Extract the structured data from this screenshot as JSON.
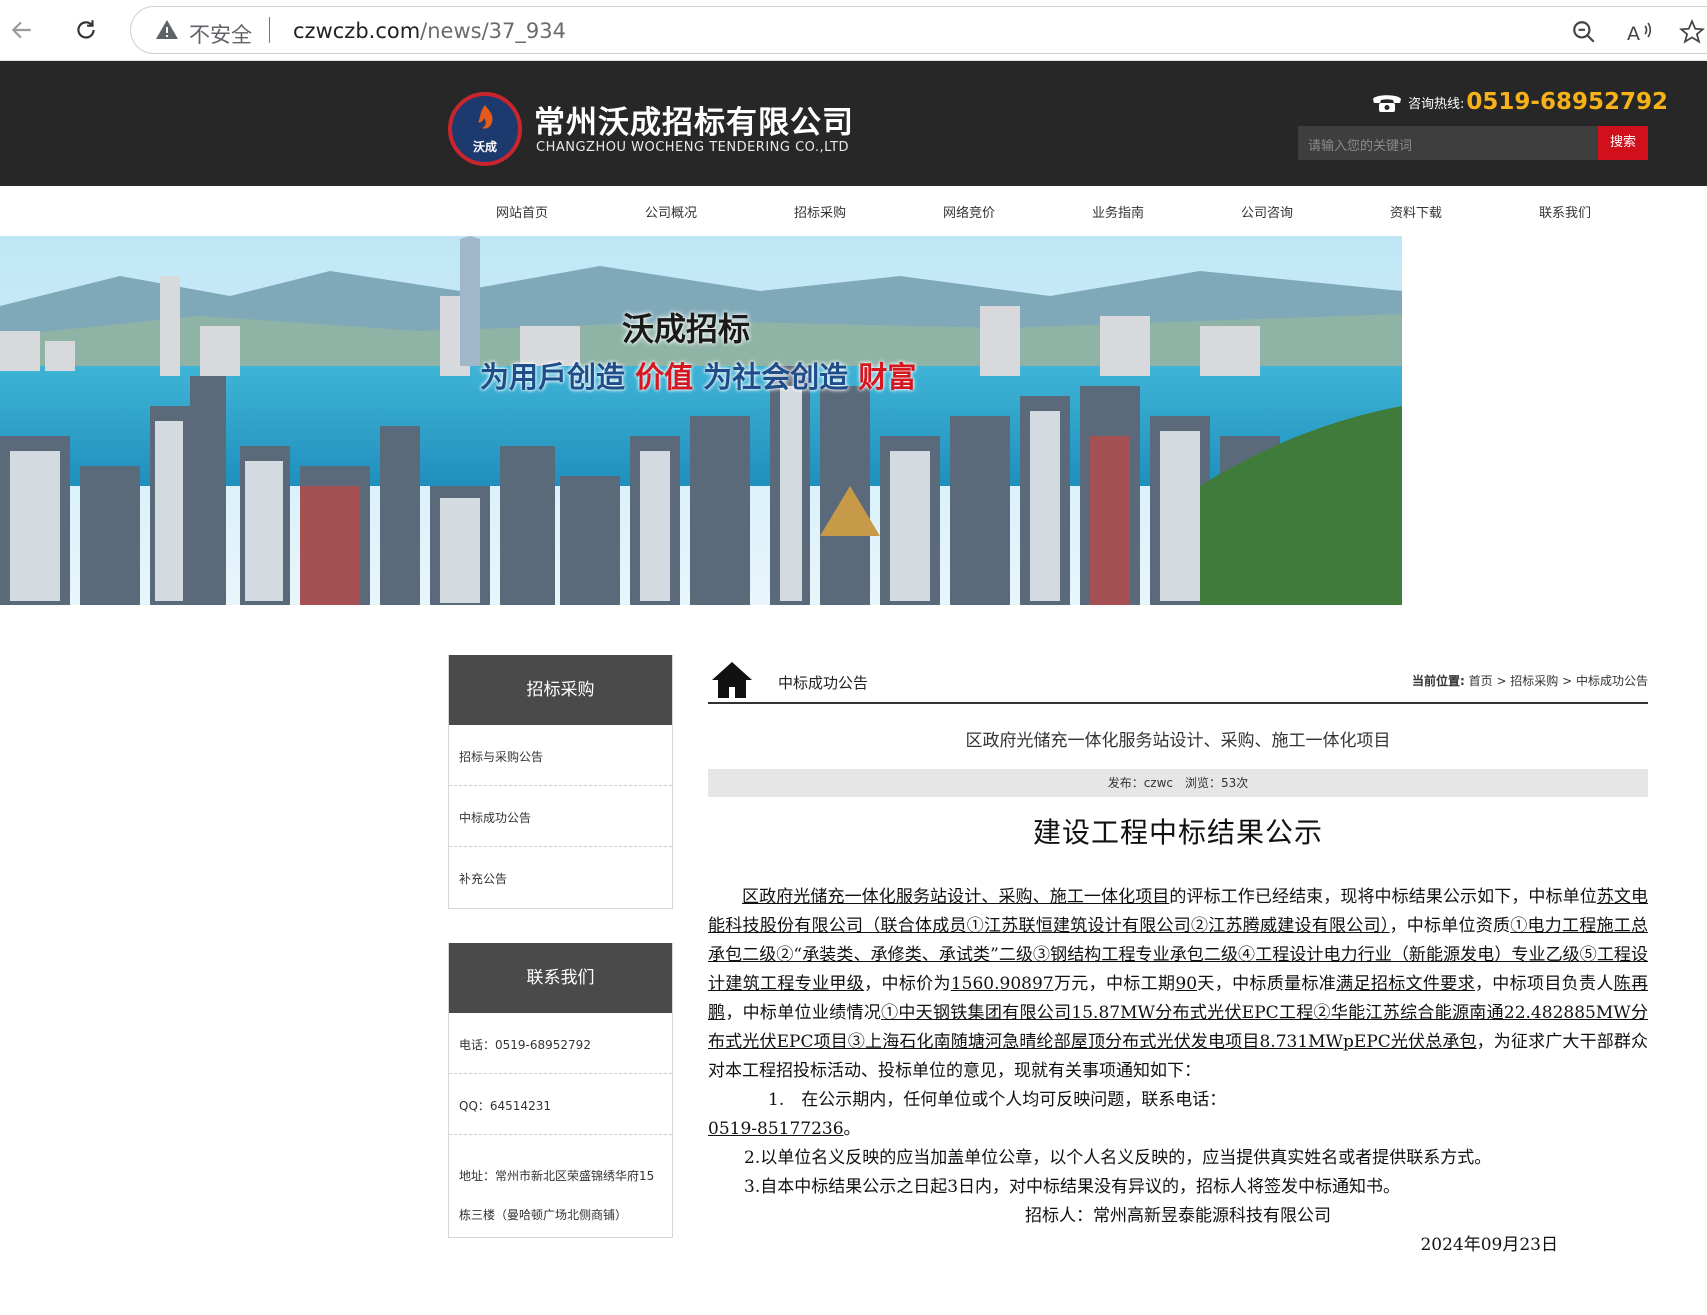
{
  "browser": {
    "insecure_label": "不安全",
    "url_host": "czwczb.com",
    "url_path": "/news/37_934"
  },
  "header": {
    "logo_text": "沃成",
    "company_name": "常州沃成招标有限公司",
    "company_en": "CHANGZHOU WOCHENG TENDERING CO.,LTD",
    "hotline_label": "咨询热线:",
    "hotline_number": "0519-68952792",
    "search_placeholder": "请输入您的关键词",
    "search_button": "搜索"
  },
  "nav": [
    "网站首页",
    "公司概况",
    "招标采购",
    "网络竞价",
    "业务指南",
    "公司咨询",
    "资料下载",
    "联系我们"
  ],
  "banner": {
    "title": "沃成招标",
    "slogan_1": "为用戶创造",
    "slogan_2": "价值",
    "slogan_3": "为社会创造",
    "slogan_4": "财富"
  },
  "sidebar": {
    "bidding": {
      "title": "招标采购",
      "items": [
        "招标与采购公告",
        "中标成功公告",
        "补充公告"
      ]
    },
    "contact": {
      "title": "联系我们",
      "phone": "电话：0519-68952792",
      "qq": "QQ：64514231",
      "address": "地址：常州市新北区荣盛锦绣华府15栋三楼（曼哈顿广场北侧商铺）"
    }
  },
  "content": {
    "section_title": "中标成功公告",
    "breadcrumb_label": "当前位置:",
    "breadcrumb": "首页 > 招标采购 > 中标成功公告",
    "article_title": "区政府光储充一体化服务站设计、采购、施工一体化项目",
    "meta": "发布：czwc　浏览：53次",
    "doc_title": "建设工程中标结果公示",
    "p1_a": "区政府光储充一体化服务站设计、采购、施工一体化项目",
    "p1_b": "的评标工作已经结束，现将中标结果公示如下，中标单位",
    "p1_c": "苏文电能科技股份有限公司（联合体成员①江苏联恒建筑设计有限公司②江苏腾威建设有限公司）",
    "p1_d": "，中标单位资质",
    "p1_e": "①电力工程施工总承包二级②“承装类、承修类、承试类”二级③钢结构工程专业承包二级④工程设计电力行业（新能源发电）专业乙级⑤工程设计建筑工程专业甲级",
    "p1_f": "，中标价为",
    "p1_g": "1560.90897",
    "p1_h": "万元，中标工期",
    "p1_i": "90",
    "p1_j": "天，中标质量标准",
    "p1_k": "满足招标文件要求",
    "p1_l": "，中标项目负责人",
    "p1_m": "陈再鹏",
    "p1_n": "，中标单位业绩情况",
    "p1_o": "①中天钢铁集团有限公司15.87MW分布式光伏EPC工程②华能江苏综合能源南通22.482885MW分布式光伏EPC项目③上海石化南随塘河急晴纶部屋顶分布式光伏发电项目8.731MWpEPC光伏总承包",
    "p1_p": "，为征求广大干部群众对本工程招投标活动、投标单位的意见，现就有关事项通知如下：",
    "item1": "1.　在公示期内，任何单位或个人均可反映问题，联系电话：",
    "item1_phone": "0519-85177236",
    "item1_end": "。",
    "item2": "2.以单位名义反映的应当加盖单位公章，以个人名义反映的，应当提供真实姓名或者提供联系方式。",
    "item3": "3.自本中标结果公示之日起3日内，对中标结果没有异议的，招标人将签发中标通知书。",
    "signer": "招标人：常州高新昱泰能源科技有限公司",
    "date": "2024年09月23日"
  }
}
